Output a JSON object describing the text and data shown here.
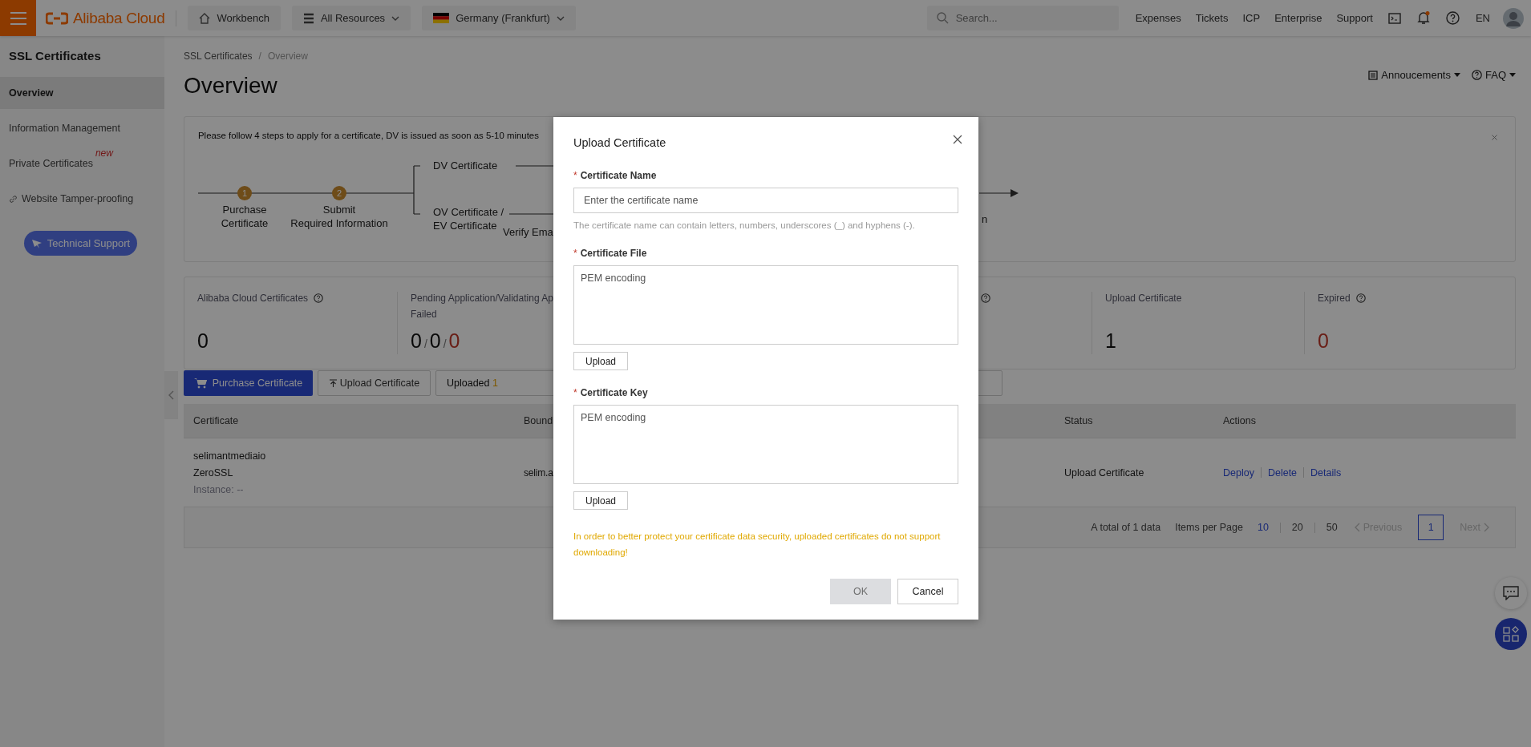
{
  "topbar": {
    "logo": "Alibaba Cloud",
    "nav_buttons": [
      {
        "kind": "home",
        "label": "Workbench"
      },
      {
        "kind": "resources",
        "label": "All Resources"
      },
      {
        "kind": "region",
        "label": "Germany (Frankfurt)"
      }
    ],
    "search": {
      "placeholder": "Search..."
    },
    "links": [
      "Expenses",
      "Tickets",
      "ICP",
      "Enterprise",
      "Support"
    ],
    "notification_dot": true,
    "language": "EN"
  },
  "sidebar": {
    "title": "SSL Certificates",
    "items": [
      {
        "label": "Overview",
        "selected": true
      },
      {
        "label": "Information Management",
        "selected": false
      },
      {
        "label": "Private Certificates",
        "selected": false,
        "badge": "new"
      },
      {
        "label": "Website Tamper-proofing",
        "selected": false,
        "kind": "link"
      }
    ],
    "support_button": "Technical Support"
  },
  "breadcrumb": {
    "items": [
      "SSL Certificates",
      "Overview"
    ],
    "separator": "/"
  },
  "page_title": "Overview",
  "header_links": [
    {
      "kind": "announcements",
      "label": "Annoucements"
    },
    {
      "kind": "faq",
      "label": "FAQ"
    }
  ],
  "steps": {
    "notice": "Please follow 4 steps to apply for a certificate, DV is issued as soon as 5-10 minutes",
    "steps": [
      {
        "number": "1",
        "label": "Purchase\nCertificate"
      },
      {
        "number": "2",
        "label": "Submit\nRequired Information"
      }
    ],
    "branches": [
      "DV Certificate",
      "OV Certificate /\nEV Certificate"
    ],
    "fragments": [
      "Verify Ema",
      "n"
    ]
  },
  "stats": [
    {
      "kind": "single",
      "label": "Alibaba Cloud Certificates",
      "help": true,
      "values": [
        {
          "text": "0",
          "alert": false
        }
      ]
    },
    {
      "kind": "multi",
      "label": "Pending Application/Validating Ap",
      "sublabel": "Failed",
      "help": false,
      "separator": "/",
      "values": [
        {
          "text": "0",
          "alert": false
        },
        {
          "text": "0",
          "alert": false
        },
        {
          "text": "0",
          "alert": true
        }
      ]
    },
    {
      "kind": "hidden",
      "help": true
    },
    {
      "kind": "single",
      "label": "Upload Certificate",
      "help": false,
      "values": [
        {
          "text": "1",
          "alert": false
        }
      ]
    },
    {
      "kind": "single",
      "label": "Expired",
      "help": true,
      "values": [
        {
          "text": "0",
          "alert": true
        }
      ]
    }
  ],
  "toolbar": {
    "purchase_button": "Purchase Certificate",
    "upload_button": "Upload Certificate",
    "tabs": [
      {
        "label": "Uploaded",
        "count": "1",
        "selected": true
      }
    ]
  },
  "table": {
    "columns": [
      "Certificate",
      "Bound",
      "",
      "Status",
      "Actions"
    ],
    "rows": [
      {
        "certificate": [
          "selimantmediaio",
          "ZeroSSL"
        ],
        "instance": "Instance: --",
        "bound": "selim.a",
        "status": "Upload Certificate",
        "actions": [
          "Deploy",
          "Delete",
          "Details"
        ]
      }
    ]
  },
  "pagination": {
    "total": "A total of 1 data",
    "per_page_label": "Items per Page",
    "sizes": [
      {
        "label": "10",
        "selected": true
      },
      {
        "label": "20",
        "selected": false
      },
      {
        "label": "50",
        "selected": false
      }
    ],
    "previous": {
      "label": "Previous",
      "disabled": true
    },
    "pages": [
      {
        "label": "1",
        "selected": true
      }
    ],
    "next": {
      "label": "Next",
      "disabled": true
    }
  },
  "modal": {
    "title": "Upload Certificate",
    "fields": [
      {
        "kind": "input",
        "label": "Certificate Name",
        "required_mark": "*",
        "placeholder": "Enter the certificate name",
        "hint": "The certificate name can contain letters, numbers, underscores (_) and hyphens (-)."
      },
      {
        "kind": "textarea",
        "label": "Certificate File",
        "required_mark": "*",
        "placeholder": "PEM encoding",
        "button": "Upload"
      },
      {
        "kind": "textarea",
        "label": "Certificate Key",
        "required_mark": "*",
        "placeholder": "PEM encoding",
        "button": "Upload"
      }
    ],
    "warning": "In order to better protect your certificate data security, uploaded certificates do not support downloading!",
    "buttons": [
      {
        "label": "OK",
        "disabled": true
      },
      {
        "label": "Cancel",
        "disabled": false
      }
    ]
  }
}
